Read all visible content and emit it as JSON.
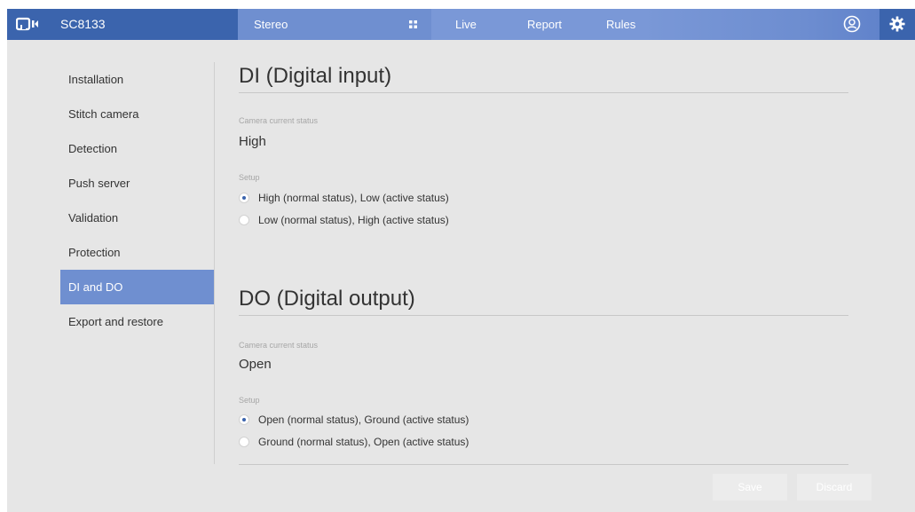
{
  "header": {
    "model": "SC8133",
    "mode_label": "Stereo",
    "tabs": [
      "Live",
      "Report",
      "Rules"
    ],
    "icons": {
      "logo": "vivotek-logo-icon",
      "grid": "grid-icon",
      "user": "user-icon",
      "settings": "gear-icon"
    },
    "colors": {
      "bar": "#3b64ad",
      "mode_bg": "#6f8fd0",
      "tabs_bg": "#7a98d7"
    }
  },
  "sidebar": {
    "items": [
      {
        "label": "Installation",
        "active": false
      },
      {
        "label": "Stitch camera",
        "active": false
      },
      {
        "label": "Detection",
        "active": false
      },
      {
        "label": "Push server",
        "active": false
      },
      {
        "label": "Validation",
        "active": false
      },
      {
        "label": "Protection",
        "active": false
      },
      {
        "label": "DI and DO",
        "active": true
      },
      {
        "label": "Export and restore",
        "active": false
      }
    ]
  },
  "di": {
    "title": "DI (Digital input)",
    "status_label": "Camera current status",
    "status_value": "High",
    "setup_label": "Setup",
    "options": [
      {
        "label": "High (normal status), Low (active status)",
        "checked": true
      },
      {
        "label": "Low (normal status), High (active status)",
        "checked": false
      }
    ]
  },
  "do": {
    "title": "DO (Digital output)",
    "status_label": "Camera current status",
    "status_value": "Open",
    "setup_label": "Setup",
    "options": [
      {
        "label": "Open (normal status), Ground (active status)",
        "checked": true
      },
      {
        "label": "Ground (normal status), Open (active status)",
        "checked": false
      }
    ]
  },
  "actions": {
    "save_label": "Save",
    "discard_label": "Discard"
  }
}
